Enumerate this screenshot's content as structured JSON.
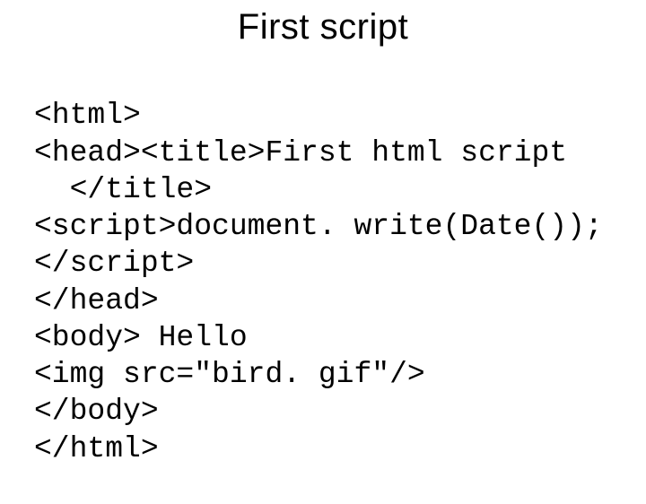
{
  "title": "First script",
  "code_lines": {
    "l1": "<html>",
    "l2": "<head><title>First html script",
    "l3": "  </title>",
    "l4": "<script>document. write(Date());",
    "l5": "</script>",
    "l6": "</head>",
    "l7": "<body> Hello",
    "l8": "<img src=\"bird. gif\"/>",
    "l9": "</body>",
    "l10": "</html>"
  }
}
